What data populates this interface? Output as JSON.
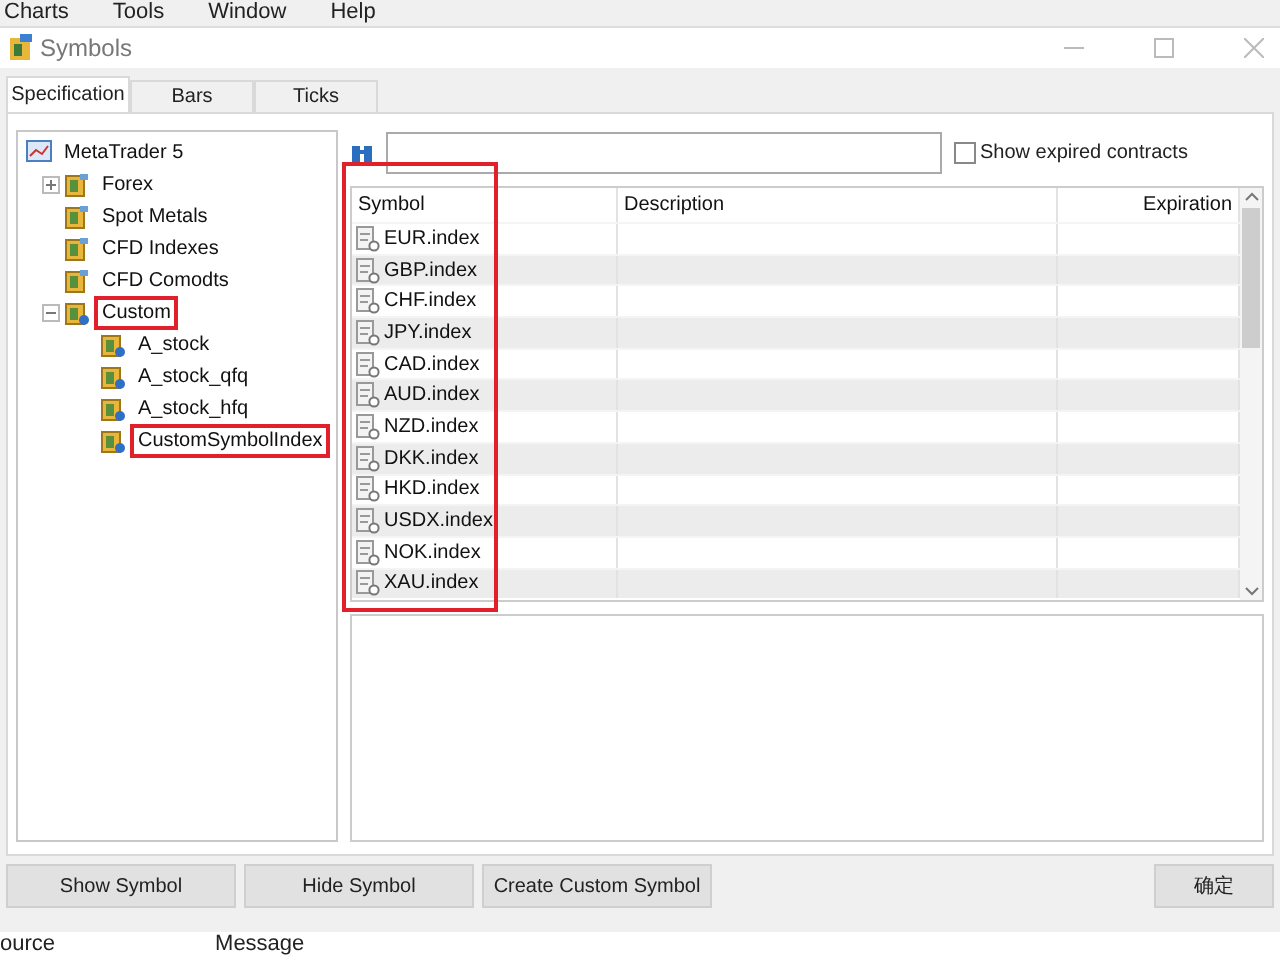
{
  "menu_bar": [
    "Charts",
    "Tools",
    "Window",
    "Help"
  ],
  "window": {
    "title": "Symbols"
  },
  "tabs": [
    {
      "label": "Specification",
      "selected": true
    },
    {
      "label": "Bars",
      "selected": false
    },
    {
      "label": "Ticks",
      "selected": false
    }
  ],
  "tree": {
    "label": "MetaTrader 5",
    "children": [
      {
        "label": "Forex",
        "expanded": false,
        "highlighted": false,
        "kind": "group"
      },
      {
        "label": "Spot Metals",
        "highlighted": false,
        "kind": "group"
      },
      {
        "label": "CFD Indexes",
        "highlighted": false,
        "kind": "group"
      },
      {
        "label": "CFD Comodts",
        "highlighted": false,
        "kind": "group"
      },
      {
        "label": "Custom",
        "expanded": true,
        "highlighted": true,
        "kind": "custom",
        "children": [
          {
            "label": "A_stock",
            "highlighted": false,
            "kind": "custom"
          },
          {
            "label": "A_stock_qfq",
            "highlighted": false,
            "kind": "custom"
          },
          {
            "label": "A_stock_hfq",
            "highlighted": false,
            "kind": "custom"
          },
          {
            "label": "CustomSymbolIndex",
            "highlighted": true,
            "kind": "custom"
          }
        ]
      }
    ]
  },
  "search": {
    "focused": false
  },
  "show_expired": {
    "label": "Show expired contracts",
    "checked": false
  },
  "table": {
    "columns": [
      "Symbol",
      "Description",
      "Expiration"
    ],
    "symbol_column_highlighted": true,
    "rows": [
      {
        "symbol": "EUR.index"
      },
      {
        "symbol": "GBP.index"
      },
      {
        "symbol": "CHF.index"
      },
      {
        "symbol": "JPY.index"
      },
      {
        "symbol": "CAD.index"
      },
      {
        "symbol": "AUD.index"
      },
      {
        "symbol": "NZD.index"
      },
      {
        "symbol": "DKK.index"
      },
      {
        "symbol": "HKD.index"
      },
      {
        "symbol": "USDX.index"
      },
      {
        "symbol": "NOK.index"
      },
      {
        "symbol": "XAU.index"
      }
    ]
  },
  "buttons": [
    "Show Symbol",
    "Hide Symbol",
    "Create Custom Symbol"
  ],
  "ok_button": "确定",
  "log_columns": [
    "ource",
    "Message"
  ]
}
